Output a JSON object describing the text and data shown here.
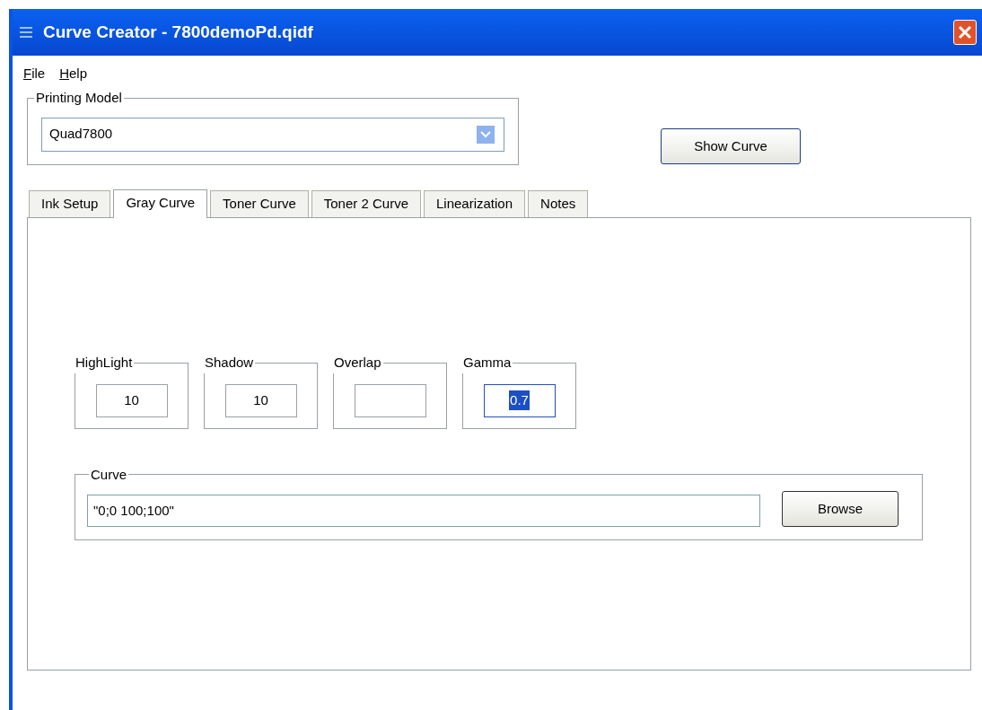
{
  "window": {
    "title": "Curve Creator - 7800demoPd.qidf"
  },
  "menu": [
    {
      "label": "File"
    },
    {
      "label": "Help"
    }
  ],
  "printing_model": {
    "label": "Printing Model",
    "value": "Quad7800"
  },
  "show_curve_button": "Show Curve",
  "tabs": [
    {
      "label": "Ink Setup",
      "selected": false
    },
    {
      "label": "Gray Curve",
      "selected": true
    },
    {
      "label": "Toner Curve",
      "selected": false
    },
    {
      "label": "Toner 2 Curve",
      "selected": false
    },
    {
      "label": "Linearization",
      "selected": false
    },
    {
      "label": "Notes",
      "selected": false
    }
  ],
  "parameters": [
    {
      "label": "HighLight",
      "value": "10",
      "selected": false
    },
    {
      "label": "Shadow",
      "value": "10",
      "selected": false
    },
    {
      "label": "Overlap",
      "selected": false
    },
    {
      "label": "Gamma",
      "value": "0.7",
      "selected": true
    }
  ],
  "curve": {
    "label": "Curve",
    "value": "\"0;0 100;100\"",
    "button": "Browse"
  }
}
